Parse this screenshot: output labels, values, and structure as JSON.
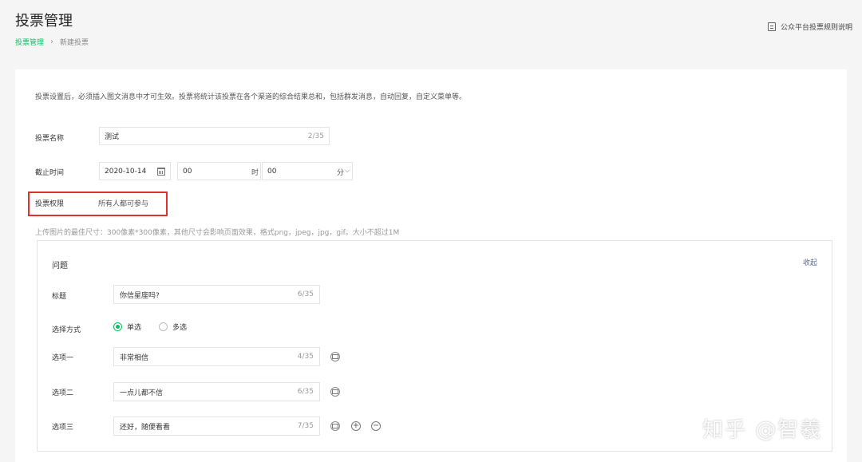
{
  "header": {
    "title": "投票管理",
    "breadcrumb": [
      "投票管理",
      "新建投票"
    ],
    "breadcrumb_sep": "›",
    "rules_link": "公众平台投票规则说明"
  },
  "form": {
    "notice": "投票设置后，必须插入图文消息中才可生效。投票将统计该投票在各个渠道的综合结果总和，包括群发消息，自动回复，自定义菜单等。",
    "name_label": "投票名称",
    "name_value": "测试",
    "name_counter": "2/35",
    "deadline_label": "截止时间",
    "deadline_date": "2020-10-14",
    "deadline_hour": "00",
    "hour_unit": "时",
    "deadline_minute": "00",
    "minute_unit": "分",
    "permission_label": "投票权限",
    "permission_value": "所有人都可参与",
    "upload_tip": "上传图片的最佳尺寸：300像素*300像素，其他尺寸会影响页面效果，格式png，jpeg，jpg，gif。大小不超过1M"
  },
  "question": {
    "header": "问题",
    "collapse": "收起",
    "title_label": "标题",
    "title_value": "你信星座吗?",
    "title_counter": "6/35",
    "mode_label": "选择方式",
    "mode_single": "单选",
    "mode_multi": "多选",
    "options": [
      {
        "label": "选项一",
        "value": "非常相信",
        "counter": "4/35"
      },
      {
        "label": "选项二",
        "value": "一点儿都不信",
        "counter": "6/35"
      },
      {
        "label": "选项三",
        "value": "还好，随便看看",
        "counter": "7/35"
      }
    ],
    "add_symbol": "+",
    "remove_symbol": "−"
  },
  "watermark": "知乎 @智羲",
  "colors": {
    "accent": "#07c160",
    "highlight": "#e0302f",
    "link": "#576b95"
  }
}
